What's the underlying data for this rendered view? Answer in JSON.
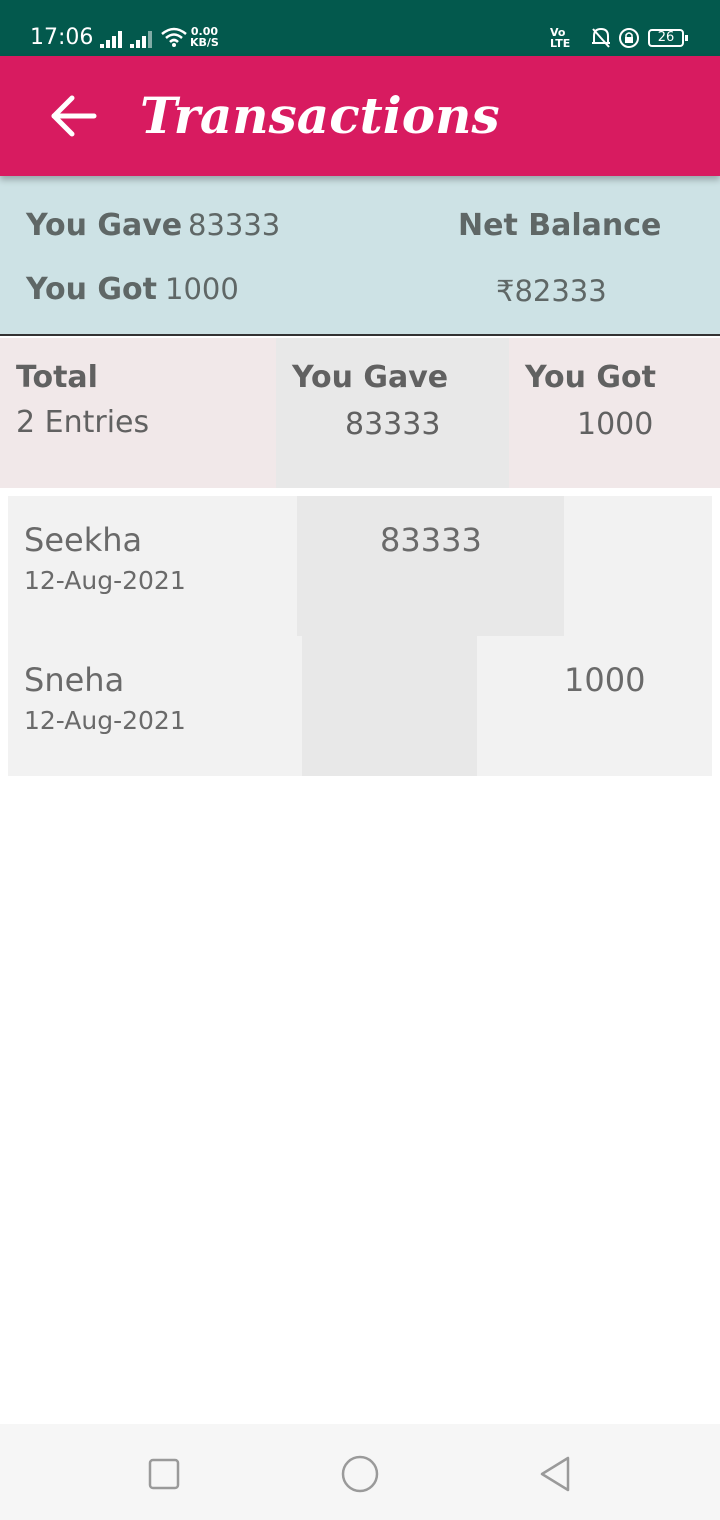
{
  "status_bar": {
    "time": "17:06",
    "net_speed_value": "0.00",
    "net_speed_unit": "KB/S",
    "volte_top": "Vo",
    "volte_bottom": "LTE",
    "battery": "26",
    "bg_color": "#03594d"
  },
  "app_bar": {
    "title": "Transactions",
    "back_icon": "arrow-left-icon",
    "bg_color": "#d81b60"
  },
  "summary": {
    "you_gave_label": "You Gave",
    "you_gave_value": "83333",
    "you_got_label": "You Got",
    "you_got_value": "1000",
    "net_balance_label": "Net Balance",
    "net_balance_value": "₹82333",
    "bg_color": "#cde2e5"
  },
  "totals": {
    "total_label": "Total",
    "entries_count": "2 Entries",
    "gave_label": "You Gave",
    "gave_value": "83333",
    "got_label": "You Got",
    "got_value": "1000"
  },
  "entries": [
    {
      "name": "Seekha",
      "date": "12-Aug-2021",
      "gave": "83333",
      "got": ""
    },
    {
      "name": "Sneha",
      "date": "12-Aug-2021",
      "gave": "",
      "got": "1000"
    }
  ],
  "nav_bar": {
    "icons": [
      "recents-square-icon",
      "home-circle-icon",
      "back-triangle-icon"
    ]
  }
}
